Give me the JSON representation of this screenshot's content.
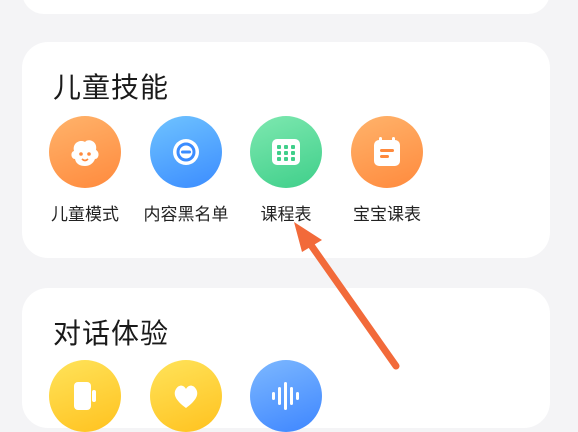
{
  "sections": {
    "kids": {
      "title": "儿童技能",
      "items": [
        {
          "label": "儿童模式",
          "icon": "baby-face-icon",
          "color_from": "#ffb36b",
          "color_to": "#ff8a3d"
        },
        {
          "label": "内容黑名单",
          "icon": "minus-circle-icon",
          "color_from": "#6fc3ff",
          "color_to": "#3b8cff"
        },
        {
          "label": "课程表",
          "icon": "calendar-grid-icon",
          "color_from": "#7ee8b0",
          "color_to": "#3fcf8a"
        },
        {
          "label": "宝宝课表",
          "icon": "notebook-icon",
          "color_from": "#ffb36b",
          "color_to": "#ff8a3d"
        }
      ]
    },
    "chat": {
      "title": "对话体验",
      "items": [
        {
          "icon": "phone-icon",
          "color_from": "#ffe35a",
          "color_to": "#ffc21f"
        },
        {
          "icon": "heart-icon",
          "color_from": "#ffe35a",
          "color_to": "#ffc21f"
        },
        {
          "icon": "soundwave-icon",
          "color_from": "#7db8ff",
          "color_to": "#3e86ff"
        }
      ]
    }
  },
  "annotation": {
    "color": "#f26a3a"
  }
}
